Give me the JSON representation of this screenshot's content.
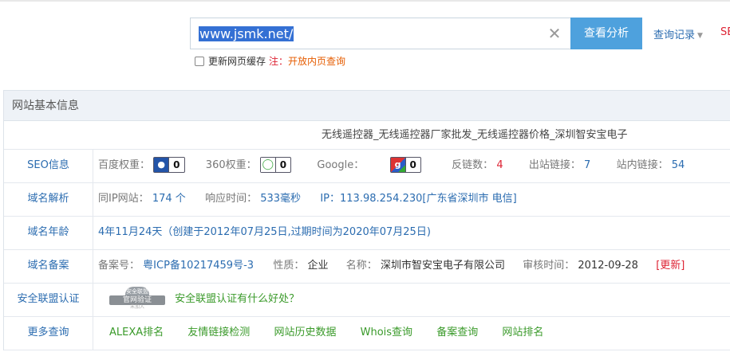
{
  "search": {
    "value": "www.jsmk.net/",
    "button": "查看分析",
    "history": "查询记录",
    "seo_cut": "SE"
  },
  "cache": {
    "label": "更新网页缓存",
    "note_prefix": "注：",
    "note_link": "开放内页查询"
  },
  "panel": {
    "title": "网站基本信息",
    "site_title": "无线遥控器_无线遥控器厂家批发_无线遥控器价格_深圳智安宝电子",
    "seo": {
      "label": "SEO信息",
      "baidu_label": "百度权重：",
      "baidu_value": "0",
      "w360_label": "360权重：",
      "w360_value": "0",
      "google_label": "Google：",
      "google_value": "0",
      "backlinks_label": "反链数：",
      "backlinks_value": "4",
      "outlinks_label": "出站链接：",
      "outlinks_value": "7",
      "inlinks_label": "站内链接：",
      "inlinks_value": "54"
    },
    "dns": {
      "label": "域名解析",
      "sameip_label": "同IP网站：",
      "sameip_value": "174 个",
      "resp_label": "响应时间：",
      "resp_value": "533毫秒",
      "ip_text": "IP：113.98.254.230[广东省深圳市 电信]"
    },
    "age": {
      "label": "域名年龄",
      "value": "4年11月24天（创建于2012年07月25日,过期时间为2020年07月25日)"
    },
    "beian": {
      "label": "域名备案",
      "num_label": "备案号：",
      "num_value": "粤ICP备10217459号-3",
      "nature_label": "性质：",
      "nature_value": "企业",
      "name_label": "名称：",
      "name_value": "深圳市智安宝电子有限公司",
      "date_label": "审核时间：",
      "date_value": "2012-09-28",
      "update": "[更新]"
    },
    "safety": {
      "label": "安全联盟认证",
      "seal_top": "安全联盟",
      "seal_main": "官网验证",
      "seal_bottom": "未加入",
      "link": "安全联盟认证有什么好处？"
    },
    "more": {
      "label": "更多查询",
      "links": [
        "ALEXA排名",
        "友情链接检测",
        "网站历史数据",
        "Whois查询",
        "备案查询",
        "网站排名"
      ]
    }
  }
}
